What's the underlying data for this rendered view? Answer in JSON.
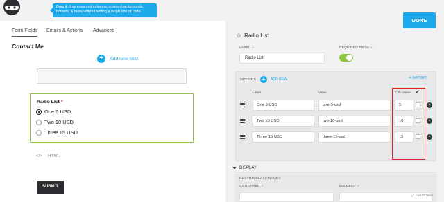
{
  "tooltip": {
    "text": "Drag & drop rows and columns, custom backgrounds, borders, & more without writing a single line of code."
  },
  "tabs": [
    {
      "label": "Form Fields"
    },
    {
      "label": "Emails & Actions"
    },
    {
      "label": "Advanced"
    }
  ],
  "form": {
    "title": "Contact Me",
    "add_field_label": "Add new field",
    "radio_field": {
      "label": "Radio List",
      "required_mark": "*",
      "options": [
        {
          "label": "One 5 USD",
          "checked": true
        },
        {
          "label": "Two 10 USD",
          "checked": false
        },
        {
          "label": "Three 15 USD",
          "checked": false
        }
      ]
    },
    "html_icon": "</>",
    "html_label": "HTML",
    "submit_label": "SUBMIT"
  },
  "panel": {
    "done_label": "DONE",
    "title": "Radio List",
    "label_caption": "LABEL",
    "label_value": "Radio List",
    "required_caption": "REQUIRED FIELD",
    "required_on": true,
    "options_caption": "OPTIONS",
    "add_new_label": "ADD NEW",
    "import_label": "IMPORT",
    "col_label": "Label",
    "col_value": "Value",
    "col_calc": "Calc Value",
    "check_header": "✔",
    "rows": [
      {
        "label": "One 5 USD",
        "value": "one-5-usd",
        "calc": "5",
        "checked": true
      },
      {
        "label": "Two 10 USD",
        "value": "two-10-usd",
        "calc": "10",
        "checked": false
      },
      {
        "label": "Three 15 USD",
        "value": "three-15-usd",
        "calc": "15",
        "checked": false
      }
    ],
    "display_label": "DISPLAY",
    "custom_class_caption": "CUSTOM CLASS NAMES",
    "container_caption": "CONTAINER",
    "element_caption": "ELEMENT",
    "fullscreen_label": "Full screen"
  },
  "colors": {
    "accent": "#1ea9ea",
    "success": "#8dc63f",
    "highlight": "#e0201b",
    "dark": "#2c2d30"
  },
  "icons": {
    "logo": "ninja-logo-icon",
    "add": "plus-circle-icon",
    "star": "star-icon",
    "delete": "close-circle-icon",
    "drag": "drag-handle-icon",
    "import": "import-arrow-icon"
  }
}
